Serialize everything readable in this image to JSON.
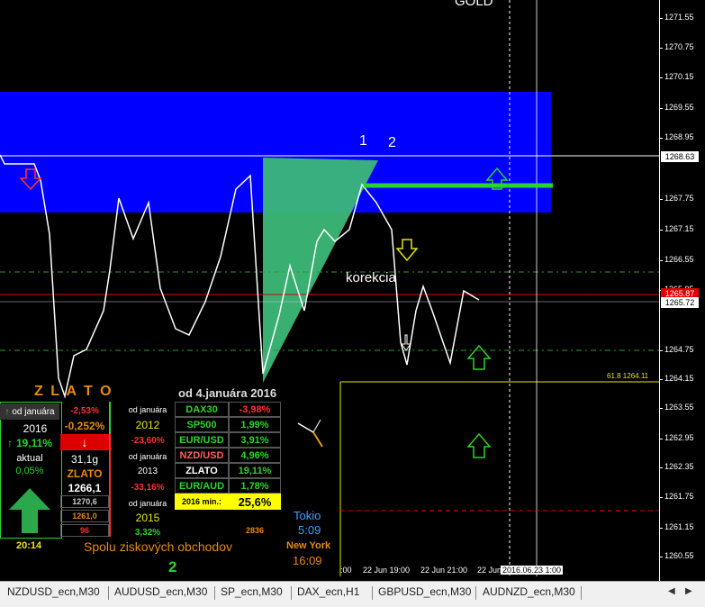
{
  "chart": {
    "symbol_title": "GOLD",
    "annot_1": "1",
    "annot_2": "2",
    "korekcia": "korekcia",
    "fib_label": "61.8   1264.11",
    "price_levels": [
      "1271.55",
      "1270.75",
      "1270.15",
      "1269.55",
      "1268.95",
      "1267.75",
      "1267.15",
      "1266.55",
      "1265.95",
      "1264.75",
      "1264.15",
      "1263.55",
      "1262.95",
      "1262.35",
      "1261.75",
      "1261.15",
      "1260.55"
    ],
    "price_current_1": "1268.63",
    "price_current_2": "1265.87",
    "price_current_3": "1265.72",
    "time_labels": [
      ":00",
      "22 Jun 19:00",
      "22 Jun 21:00",
      "22 Jun",
      "2016.06.23 1:00"
    ],
    "colors": {
      "zone": "#0000ff",
      "triangle": "#3cb878",
      "green_line": "#2ad42a",
      "red_line": "#dd0000"
    }
  },
  "panel": {
    "title": "Z L A T O",
    "subtitle": "od 4.januára 2016",
    "left": {
      "od_januara": "od januára",
      "year": "2016",
      "pct_top": "-0,252%",
      "pct_red": "-2,53%",
      "gain": "19,11%",
      "aktual": "aktual",
      "aktual_val": "0,05%",
      "weight": "31,1g",
      "zlato": "ZLATO",
      "zlato_price": "1266,1",
      "p1": "1270,6",
      "p2": "1261,0",
      "p3": "96",
      "time": "20:14"
    },
    "mid": {
      "r1_label": "od januára",
      "r1_year": "2012",
      "r1_val": "-23,60%",
      "r2_label": "od januára",
      "r2_year": "2013",
      "r2_val": "-33,16%",
      "r3_label": "od januára",
      "r3_year": "2015",
      "r3_val": "3,32%"
    },
    "table": [
      {
        "name": "DAX30",
        "val": "-3,98%",
        "neg": true
      },
      {
        "name": "SP500",
        "val": "1,99%",
        "neg": false
      },
      {
        "name": "EUR/USD",
        "val": "3,91%",
        "neg": false
      },
      {
        "name": "NZD/USD",
        "val": "4,96%",
        "neg": false
      },
      {
        "name": "ZLATO",
        "val": "19,11%",
        "neg": false
      },
      {
        "name": "EUR/AUD",
        "val": "1,78%",
        "neg": false
      }
    ],
    "min_label": "2016 min.:",
    "min_val": "25,6%",
    "count_right": "2836",
    "spolu": "Spolu ziskových obchodov",
    "spolu_val": "2",
    "tokio": "Tokio",
    "tokio_time": "5:09",
    "newyork": "New York",
    "newyork_time": "16:09"
  },
  "tabs": [
    "NZDUSD_ecn,M30",
    "AUDUSD_ecn,M30",
    "SP_ecn,M30",
    "DAX_ecn,H1",
    "GBPUSD_ecn,M30",
    "AUDNZD_ecn,M30"
  ]
}
